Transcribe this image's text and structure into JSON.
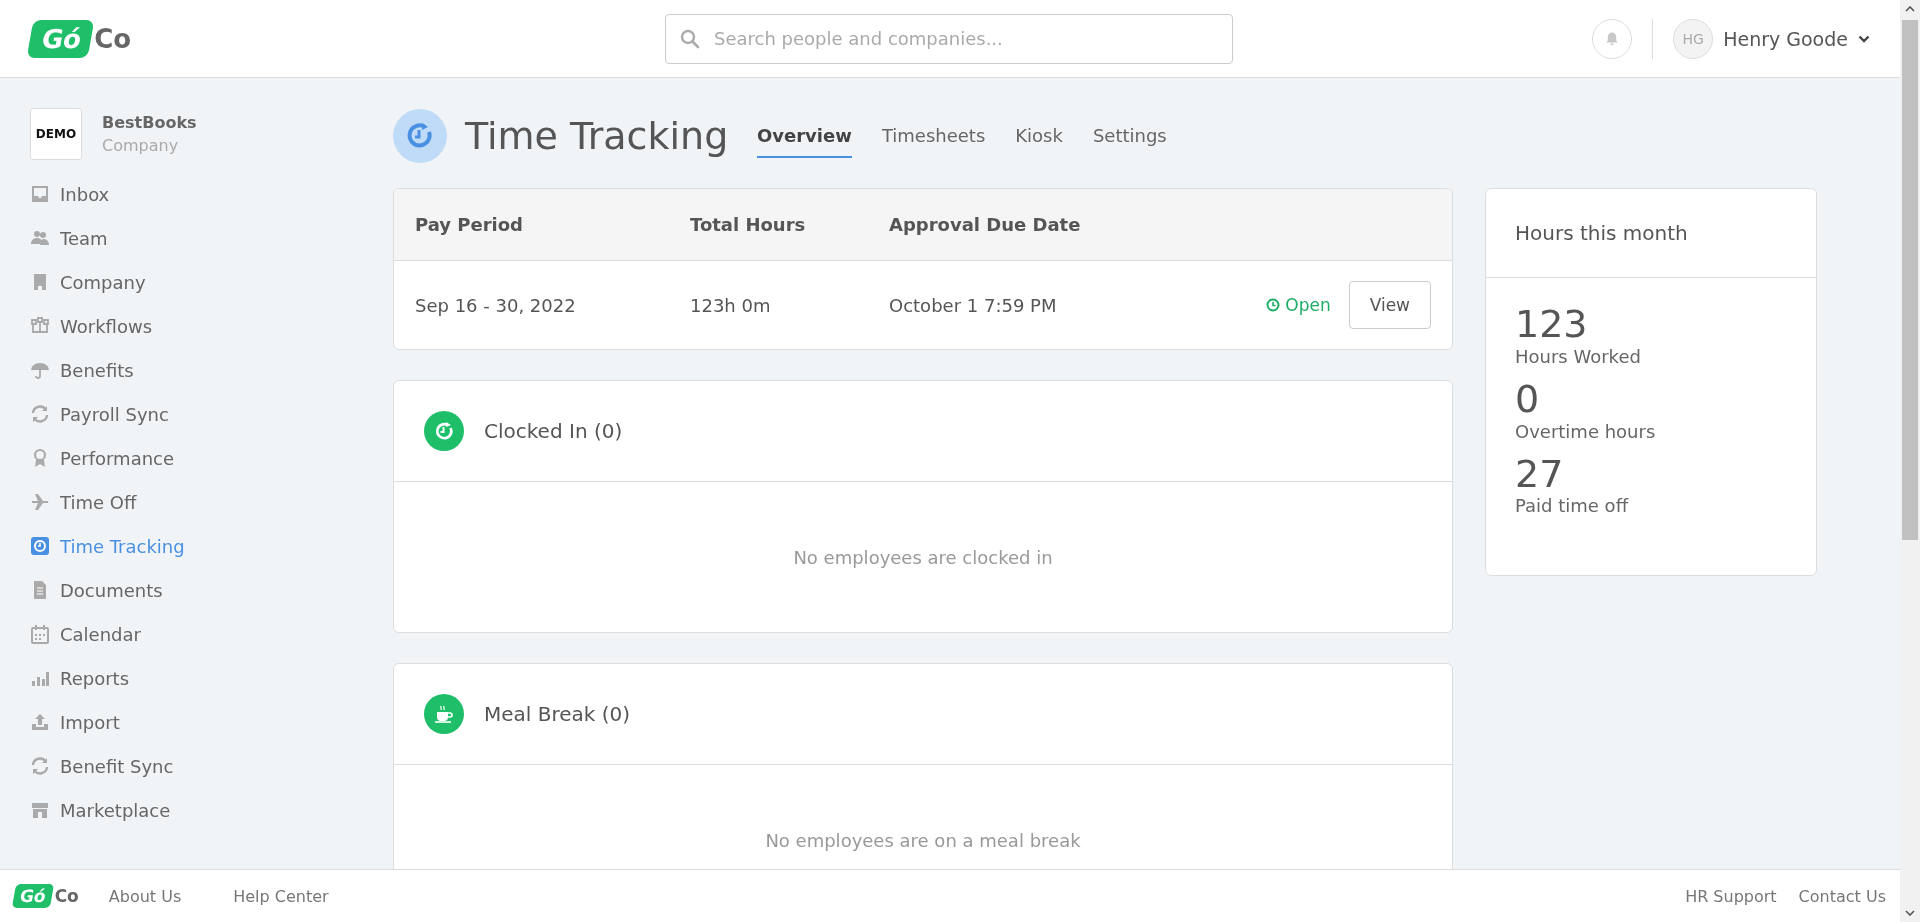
{
  "logo": {
    "mark": "Gó",
    "rest": "Co"
  },
  "search": {
    "placeholder": "Search people and companies..."
  },
  "user": {
    "initials": "HG",
    "name": "Henry Goode"
  },
  "company": {
    "badge": "DEMO",
    "name": "BestBooks",
    "subtitle": "Company"
  },
  "sidebar": {
    "items": [
      {
        "label": "Inbox",
        "selected": false
      },
      {
        "label": "Team",
        "selected": false
      },
      {
        "label": "Company",
        "selected": false
      },
      {
        "label": "Workflows",
        "selected": false
      },
      {
        "label": "Benefits",
        "selected": false
      },
      {
        "label": "Payroll Sync",
        "selected": false
      },
      {
        "label": "Performance",
        "selected": false
      },
      {
        "label": "Time Off",
        "selected": false
      },
      {
        "label": "Time Tracking",
        "selected": true
      },
      {
        "label": "Documents",
        "selected": false
      },
      {
        "label": "Calendar",
        "selected": false
      },
      {
        "label": "Reports",
        "selected": false
      },
      {
        "label": "Import",
        "selected": false
      },
      {
        "label": "Benefit Sync",
        "selected": false
      },
      {
        "label": "Marketplace",
        "selected": false
      }
    ]
  },
  "page": {
    "title": "Time Tracking"
  },
  "tabs": [
    {
      "label": "Overview",
      "selected": true
    },
    {
      "label": "Timesheets",
      "selected": false
    },
    {
      "label": "Kiosk",
      "selected": false
    },
    {
      "label": "Settings",
      "selected": false
    }
  ],
  "pay_periods": {
    "columns": [
      "Pay Period",
      "Total Hours",
      "Approval Due Date"
    ],
    "rows": [
      {
        "period": "Sep 16 - 30, 2022",
        "hours": "123h 0m",
        "due": "October 1 7:59 PM",
        "status": "Open",
        "open": true,
        "action": "View"
      }
    ]
  },
  "panels": [
    {
      "kind": "clock",
      "title": "Clocked In (0)",
      "empty": "No employees are clocked in"
    },
    {
      "kind": "meal",
      "title": "Meal Break (0)",
      "empty": "No employees are on a meal break"
    }
  ],
  "hours_card": {
    "title": "Hours this month",
    "stats": [
      {
        "value": "123",
        "label": "Hours Worked"
      },
      {
        "value": "0",
        "label": "Overtime hours"
      },
      {
        "value": "27",
        "label": "Paid time off"
      }
    ]
  },
  "footer": {
    "logo": {
      "mark": "Gó",
      "rest": "Co"
    },
    "left_links": [
      "About Us",
      "Help Center"
    ],
    "right_links": [
      "HR Support",
      "Contact Us"
    ]
  }
}
